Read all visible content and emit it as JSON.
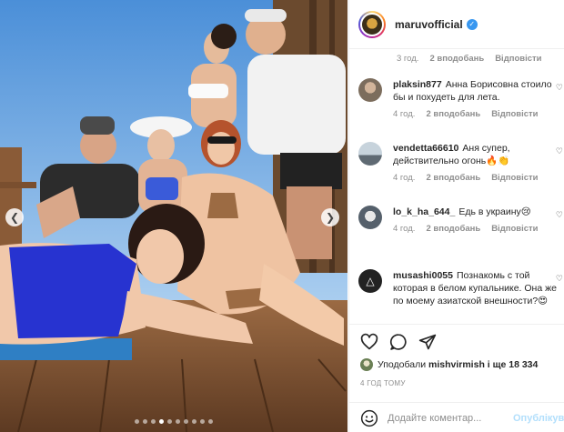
{
  "post": {
    "username": "maruvofficial",
    "verified": true,
    "avatar": "maruvofficial-avatar",
    "photo_description_icon": "group-photo",
    "carousel": {
      "slides": 10,
      "active": 4
    }
  },
  "caption_meta": {
    "time": "3 год.",
    "likes": "2 вподобань",
    "reply": "Відповісти"
  },
  "comments": [
    {
      "username": "plaksin877",
      "text": "Анна Борисовна стоило бы и похудеть для лета.",
      "time": "4 год.",
      "likes": "2 вподобань",
      "reply": "Відповісти",
      "avatar_color": "#7c6d5d"
    },
    {
      "username": "vendetta66610",
      "text": "Аня супер, действительно огонь🔥👏",
      "time": "4 год.",
      "likes": "2 вподобань",
      "reply": "Відповісти",
      "avatar_color": "#9aa8b3"
    },
    {
      "username": "lo_k_ha_644_",
      "text": "Едь в украину😢",
      "time": "4 год.",
      "likes": "2 вподобань",
      "reply": "Відповісти",
      "avatar_color": "#55606b"
    },
    {
      "username": "musashi0055",
      "text": "Познакомь с той которая в белом купальнике. Она же по моему азиатской внешности?😍",
      "time": "",
      "likes": "",
      "reply": "",
      "avatar_color": "#222222"
    }
  ],
  "actions": {
    "like_icon": "heart-outline-icon",
    "comment_icon": "comment-bubble-icon",
    "share_icon": "paper-plane-icon"
  },
  "likes": {
    "prefix": "Уподобали",
    "user": "mishvirmish",
    "suffix": "і ще 18 334"
  },
  "posted_ago": "4 ГОД ТОМУ",
  "comment_box": {
    "placeholder": "Додайте коментар...",
    "publish_label": "Опублікув",
    "emoji_icon": "smiley-icon"
  },
  "colors": {
    "accent": "#3897f0",
    "publish_disabled": "#b2dffc",
    "meta_gray": "#8e8e8e"
  }
}
